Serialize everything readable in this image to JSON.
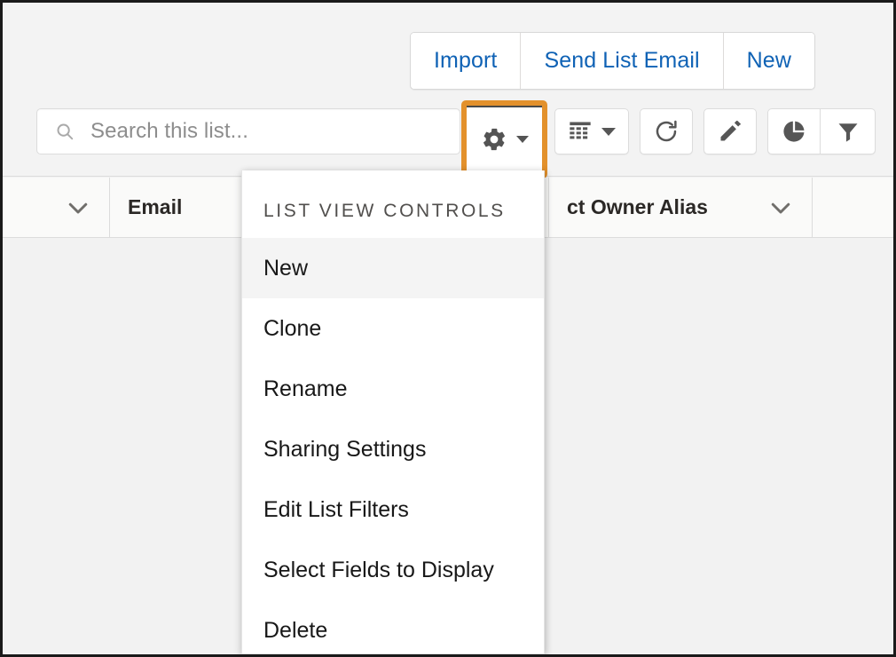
{
  "header_actions": {
    "buttons": [
      {
        "label": "Import",
        "name": "import-button"
      },
      {
        "label": "Send List Email",
        "name": "send-list-email-button"
      },
      {
        "label": "New",
        "name": "new-record-button"
      }
    ]
  },
  "toolbar": {
    "search": {
      "placeholder": "Search this list...",
      "value": "",
      "icon": "search-icon"
    },
    "list_view_controls_button": {
      "icon": "gear-icon",
      "label": "List View Controls",
      "highlighted": true,
      "highlight_color": "#e3912c"
    },
    "icon_buttons": [
      {
        "name": "list-view-display-button",
        "icon": "table-icon",
        "label": "Display as Table"
      },
      {
        "name": "refresh-button",
        "icon": "refresh-icon",
        "label": "Refresh"
      },
      {
        "name": "edit-button",
        "icon": "pencil-icon",
        "label": "Edit"
      },
      {
        "name": "charts-button",
        "icon": "pie-chart-icon",
        "label": "Charts"
      },
      {
        "name": "filter-button",
        "icon": "funnel-icon",
        "label": "Filters"
      }
    ]
  },
  "table": {
    "columns": [
      {
        "label": "",
        "sortable": true,
        "icon": "chevron-down-icon"
      },
      {
        "label": "Email",
        "sortable": true,
        "icon": "chevron-down-icon"
      },
      {
        "label": "ct Owner Alias",
        "sortable": true,
        "icon": "chevron-down-icon"
      },
      {
        "label": "",
        "sortable": false,
        "icon": ""
      }
    ],
    "rows": []
  },
  "dropdown_menu": {
    "title": "LIST VIEW CONTROLS",
    "items": [
      {
        "label": "New",
        "selected": true
      },
      {
        "label": "Clone",
        "selected": false
      },
      {
        "label": "Rename",
        "selected": false
      },
      {
        "label": "Sharing Settings",
        "selected": false
      },
      {
        "label": "Edit List Filters",
        "selected": false
      },
      {
        "label": "Select Fields to Display",
        "selected": false
      },
      {
        "label": "Delete",
        "selected": false
      }
    ]
  },
  "colors": {
    "link_blue": "#0f62b5",
    "highlight_orange": "#e3912c",
    "page_background": "#f3f3f3",
    "menu_selected": "#f4f4f4"
  }
}
